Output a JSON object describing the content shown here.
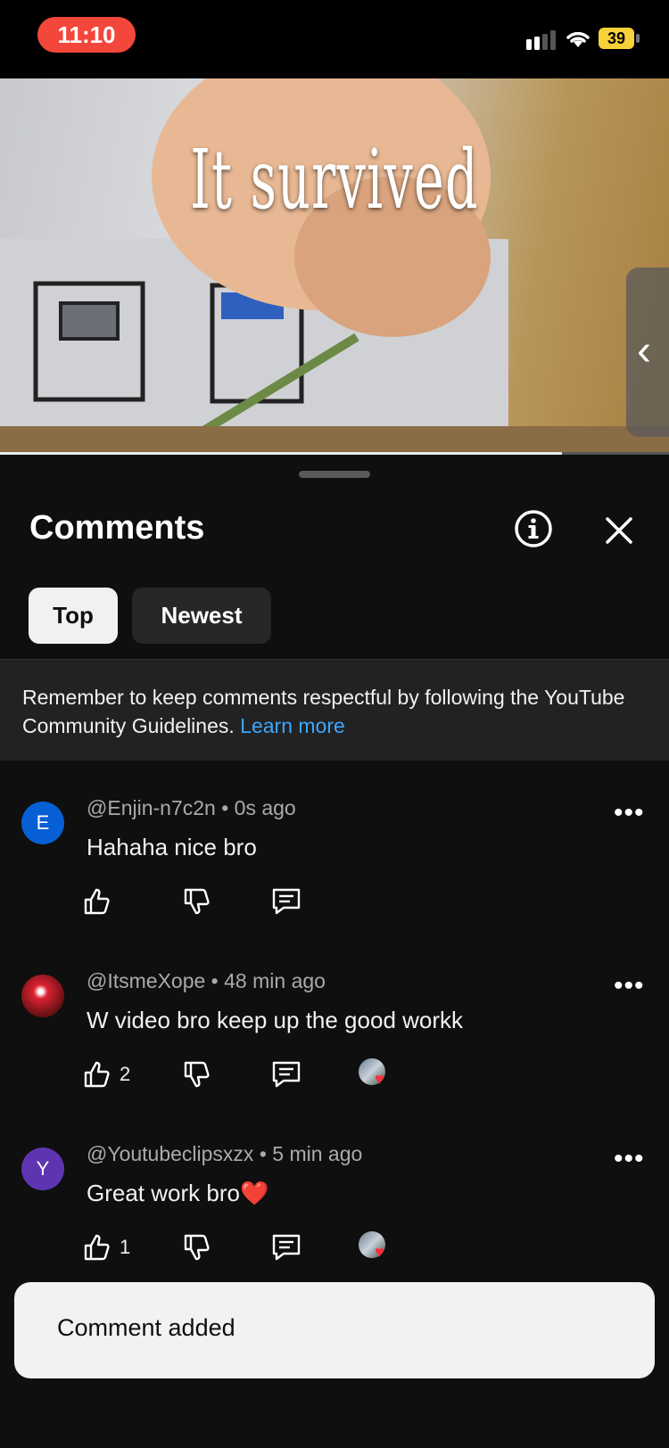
{
  "status_bar": {
    "time": "11:10",
    "battery": "39"
  },
  "video": {
    "caption": "It survived",
    "progress_fraction": 0.84
  },
  "comments_panel": {
    "title": "Comments",
    "tabs": [
      {
        "label": "Top",
        "selected": true
      },
      {
        "label": "Newest",
        "selected": false
      }
    ],
    "guideline_text": "Remember to keep comments respectful by following the YouTube Community Guidelines.",
    "guideline_link": "Learn more",
    "comments": [
      {
        "author": "@Enjin-n7c2n",
        "time": "0s ago",
        "text": "Hahaha nice bro",
        "likes": "",
        "avatar_letter": "E",
        "avatar_color": "#065fd4",
        "hearted": false
      },
      {
        "author": "@ItsmeXope",
        "time": "48 min ago",
        "text": "W video bro keep up the good workk",
        "likes": "2",
        "avatar_letter": "",
        "avatar_color": "#7a1414",
        "hearted": true
      },
      {
        "author": "@Youtubeclipsxzx",
        "time": "5 min ago",
        "text": "Great work bro❤️",
        "likes": "1",
        "avatar_letter": "Y",
        "avatar_color": "#5e35b1",
        "hearted": true
      }
    ]
  },
  "toast": {
    "text": "Comment added"
  },
  "colors": {
    "link": "#3ea6ff",
    "time_pill": "#f4473b",
    "battery": "#f6d138"
  }
}
